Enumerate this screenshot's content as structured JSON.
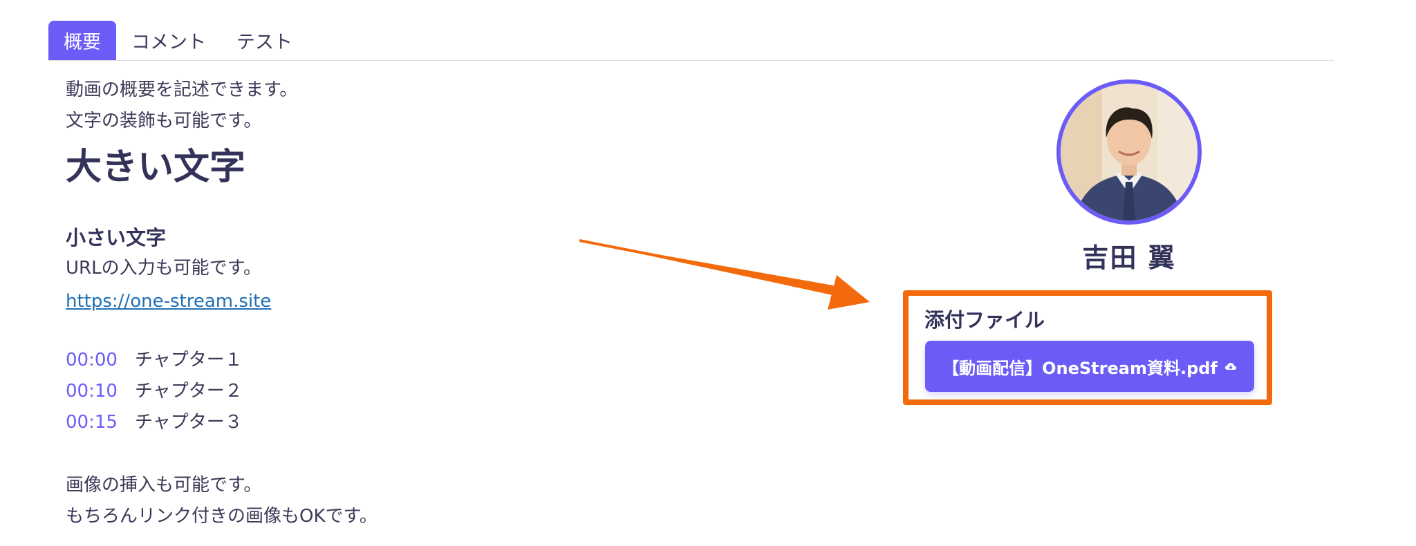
{
  "tabs": [
    {
      "label": "概要",
      "active": true
    },
    {
      "label": "コメント",
      "active": false
    },
    {
      "label": "テスト",
      "active": false
    }
  ],
  "overview": {
    "line1": "動画の概要を記述できます。",
    "line2": "文字の装飾も可能です。",
    "big_text": "大きい文字",
    "small_text": "小さい文字",
    "url_line": "URLの入力も可能です。",
    "link": "https://one-stream.site",
    "chapters": [
      {
        "time": "00:00",
        "title": "チャプター１"
      },
      {
        "time": "00:10",
        "title": "チャプター２"
      },
      {
        "time": "00:15",
        "title": "チャプター３"
      }
    ],
    "image_line": "画像の挿入も可能です。",
    "image_link_line": "もちろんリンク付きの画像もOKです。"
  },
  "presenter": {
    "name": "吉田 翼"
  },
  "attachments": {
    "title": "添付ファイル",
    "file_label": "【動画配信】OneStream資料.pdf",
    "icon": "cloud-download-icon"
  },
  "colors": {
    "accent": "#6b5cf7",
    "highlight": "#f26a0c",
    "link": "#1f6fb5"
  }
}
